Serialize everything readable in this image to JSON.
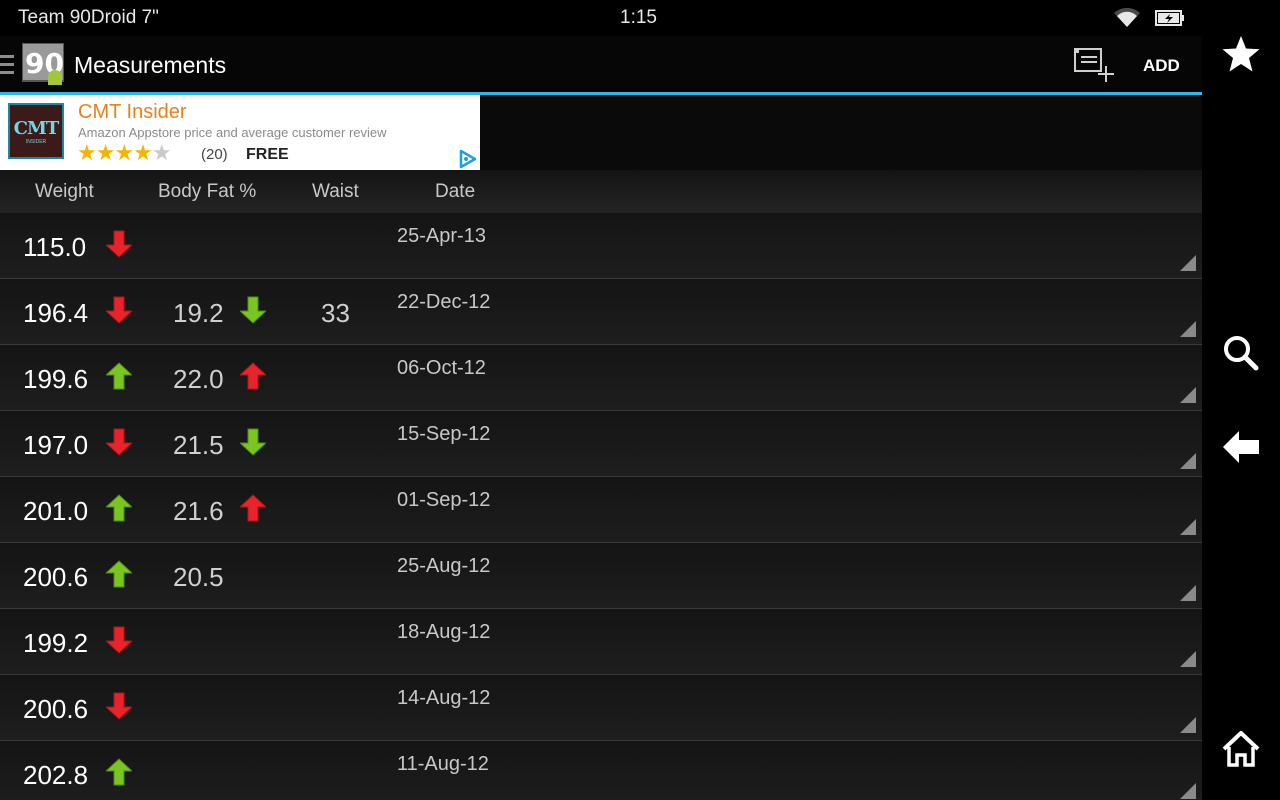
{
  "status": {
    "left": "Team 90Droid 7\"",
    "time": "1:15"
  },
  "actionbar": {
    "title": "Measurements",
    "add_label": "ADD"
  },
  "ad": {
    "logo_text": "CMT",
    "logo_sub": "INSIDER",
    "title": "CMT Insider",
    "description": "Amazon Appstore price and average customer review",
    "rating": 4.5,
    "review_count": "(20)",
    "price": "FREE"
  },
  "columns": {
    "weight": "Weight",
    "bodyfat": "Body Fat %",
    "waist": "Waist",
    "date": "Date"
  },
  "colors": {
    "accent": "#33b5e5",
    "arrow_red": "#e8232b",
    "arrow_green": "#7ac520"
  },
  "rows": [
    {
      "weight": "115.0",
      "weight_arrow": "down-red",
      "bodyfat": "",
      "bodyfat_arrow": "",
      "waist": "",
      "date": "25-Apr-13"
    },
    {
      "weight": "196.4",
      "weight_arrow": "down-red",
      "bodyfat": "19.2",
      "bodyfat_arrow": "down-green",
      "waist": "33",
      "date": "22-Dec-12"
    },
    {
      "weight": "199.6",
      "weight_arrow": "up-green",
      "bodyfat": "22.0",
      "bodyfat_arrow": "up-red",
      "waist": "",
      "date": "06-Oct-12"
    },
    {
      "weight": "197.0",
      "weight_arrow": "down-red",
      "bodyfat": "21.5",
      "bodyfat_arrow": "down-green",
      "waist": "",
      "date": "15-Sep-12"
    },
    {
      "weight": "201.0",
      "weight_arrow": "up-green",
      "bodyfat": "21.6",
      "bodyfat_arrow": "up-red",
      "waist": "",
      "date": "01-Sep-12"
    },
    {
      "weight": "200.6",
      "weight_arrow": "up-green",
      "bodyfat": "20.5",
      "bodyfat_arrow": "",
      "waist": "",
      "date": "25-Aug-12"
    },
    {
      "weight": "199.2",
      "weight_arrow": "down-red",
      "bodyfat": "",
      "bodyfat_arrow": "",
      "waist": "",
      "date": "18-Aug-12"
    },
    {
      "weight": "200.6",
      "weight_arrow": "down-red",
      "bodyfat": "",
      "bodyfat_arrow": "",
      "waist": "",
      "date": "14-Aug-12"
    },
    {
      "weight": "202.8",
      "weight_arrow": "up-green",
      "bodyfat": "",
      "bodyfat_arrow": "",
      "waist": "",
      "date": "11-Aug-12"
    }
  ],
  "sidenav": [
    "star-icon",
    "search-icon",
    "back-arrow-icon",
    "home-icon"
  ]
}
